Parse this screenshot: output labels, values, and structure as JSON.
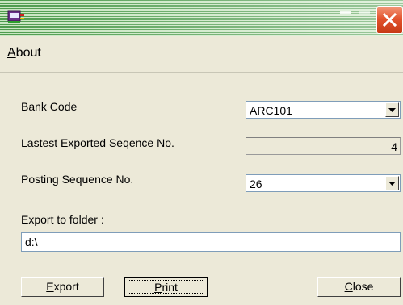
{
  "window": {
    "title": "",
    "icon": "app-window-icon"
  },
  "menu": {
    "about_label": "About",
    "about_mnemonic": "A",
    "about_rest": "bout"
  },
  "form": {
    "bank_code": {
      "label": "Bank Code",
      "value": "ARC101"
    },
    "latest_seq": {
      "label": "Lastest Exported Seqence No.",
      "value": "4"
    },
    "posting_seq": {
      "label": "Posting Sequence No.",
      "value": "26"
    },
    "export_folder": {
      "label": "Export to folder :",
      "value": "d:\\"
    }
  },
  "buttons": {
    "export": {
      "mnemonic": "E",
      "rest": "xport"
    },
    "print": {
      "mnemonic": "P",
      "rest": "rint"
    },
    "close": {
      "mnemonic": "C",
      "rest": "lose"
    }
  },
  "colors": {
    "titlebar_green": "#4d9b4d",
    "close_red": "#e2522d",
    "dialog_bg": "#ece9d8"
  }
}
